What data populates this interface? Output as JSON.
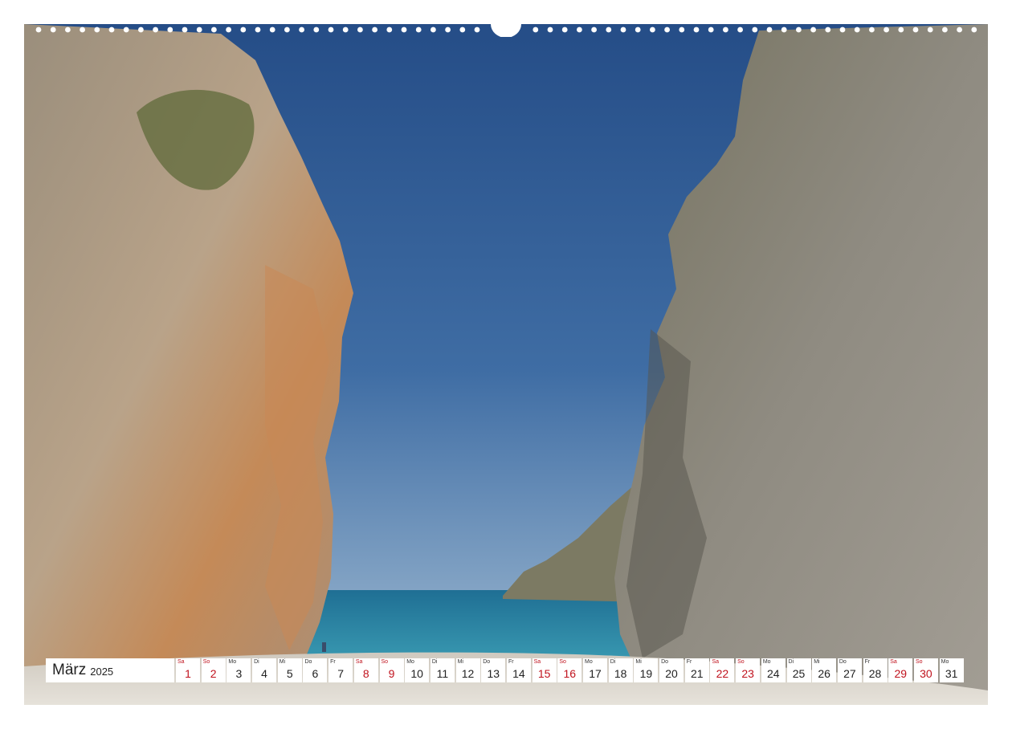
{
  "calendar": {
    "month": "März",
    "year": "2025",
    "weekend_color": "#c0121d",
    "days": [
      {
        "wd": "Sa",
        "d": "1",
        "weekend": true
      },
      {
        "wd": "So",
        "d": "2",
        "weekend": true
      },
      {
        "wd": "Mo",
        "d": "3",
        "weekend": false
      },
      {
        "wd": "Di",
        "d": "4",
        "weekend": false
      },
      {
        "wd": "Mi",
        "d": "5",
        "weekend": false
      },
      {
        "wd": "Do",
        "d": "6",
        "weekend": false
      },
      {
        "wd": "Fr",
        "d": "7",
        "weekend": false
      },
      {
        "wd": "Sa",
        "d": "8",
        "weekend": true
      },
      {
        "wd": "So",
        "d": "9",
        "weekend": true
      },
      {
        "wd": "Mo",
        "d": "10",
        "weekend": false
      },
      {
        "wd": "Di",
        "d": "11",
        "weekend": false
      },
      {
        "wd": "Mi",
        "d": "12",
        "weekend": false
      },
      {
        "wd": "Do",
        "d": "13",
        "weekend": false
      },
      {
        "wd": "Fr",
        "d": "14",
        "weekend": false
      },
      {
        "wd": "Sa",
        "d": "15",
        "weekend": true
      },
      {
        "wd": "So",
        "d": "16",
        "weekend": true
      },
      {
        "wd": "Mo",
        "d": "17",
        "weekend": false
      },
      {
        "wd": "Di",
        "d": "18",
        "weekend": false
      },
      {
        "wd": "Mi",
        "d": "19",
        "weekend": false
      },
      {
        "wd": "Do",
        "d": "20",
        "weekend": false
      },
      {
        "wd": "Fr",
        "d": "21",
        "weekend": false
      },
      {
        "wd": "Sa",
        "d": "22",
        "weekend": true
      },
      {
        "wd": "So",
        "d": "23",
        "weekend": true
      },
      {
        "wd": "Mo",
        "d": "24",
        "weekend": false
      },
      {
        "wd": "Di",
        "d": "25",
        "weekend": false
      },
      {
        "wd": "Mi",
        "d": "26",
        "weekend": false
      },
      {
        "wd": "Do",
        "d": "27",
        "weekend": false
      },
      {
        "wd": "Fr",
        "d": "28",
        "weekend": false
      },
      {
        "wd": "Sa",
        "d": "29",
        "weekend": true
      },
      {
        "wd": "So",
        "d": "30",
        "weekend": true
      },
      {
        "wd": "Mo",
        "d": "31",
        "weekend": false
      }
    ]
  },
  "photo": {
    "sky_color": "#2f5b95",
    "sea_color": "#2b8cab",
    "rock_left_color": "#b39c84",
    "rock_right_color": "#8e8a80",
    "beach_color": "#ddd8cf"
  }
}
